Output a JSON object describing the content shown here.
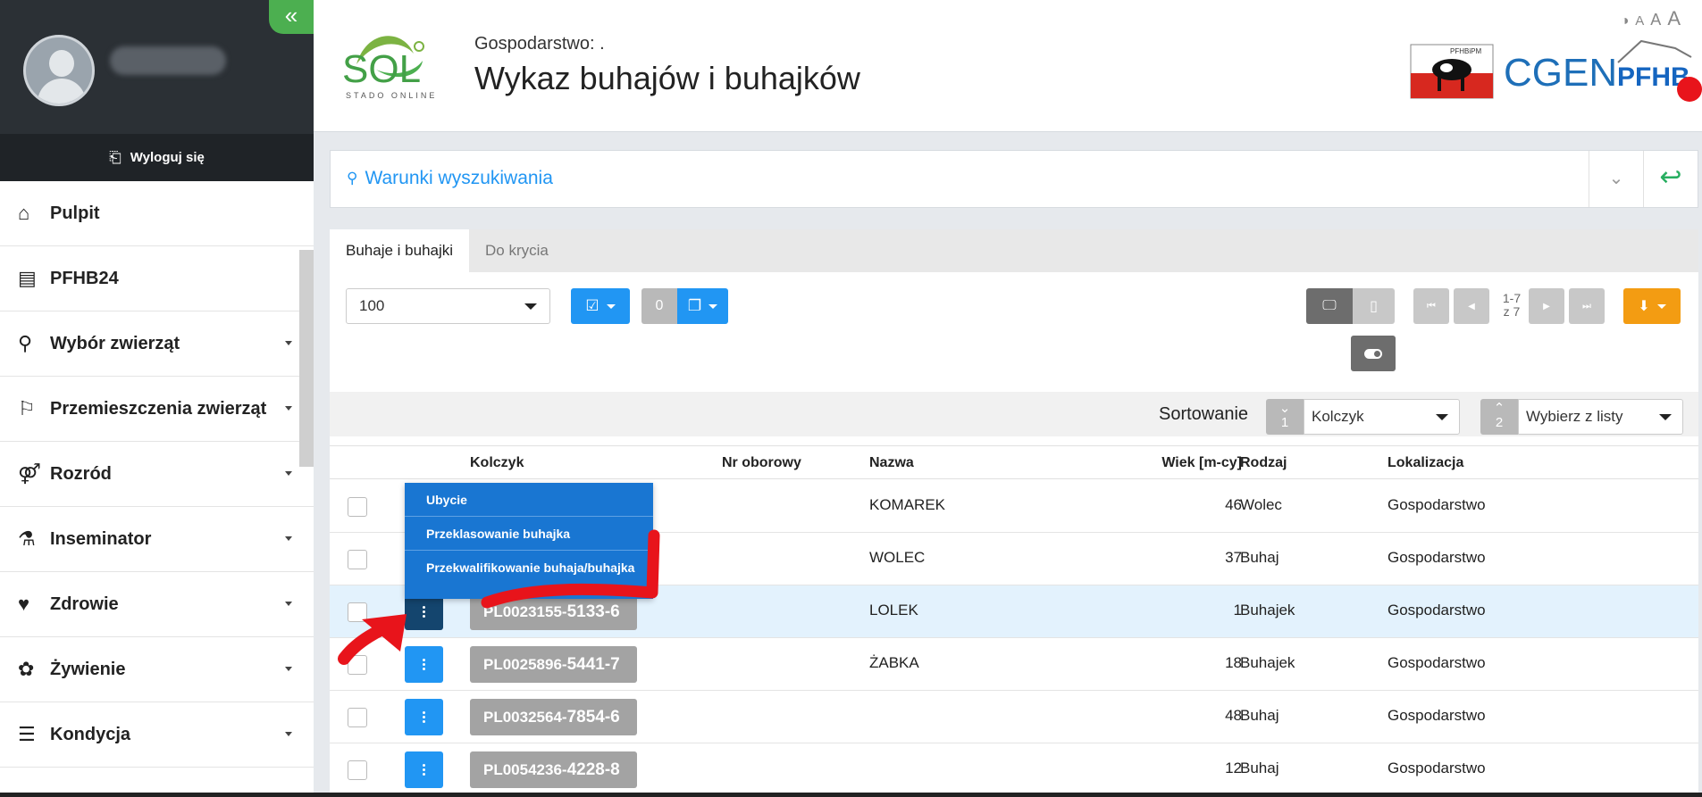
{
  "sidebar": {
    "collapse_icon": "«",
    "logout_label": "Wyloguj się",
    "items": [
      {
        "label": "Pulpit",
        "icon": "home-icon"
      },
      {
        "label": "PFHB24",
        "icon": "document-icon"
      },
      {
        "label": "Wybór zwierząt",
        "icon": "search-icon"
      },
      {
        "label": "Przemieszczenia zwierząt",
        "icon": "signpost-icon"
      },
      {
        "label": "Rozród",
        "icon": "gender-icon"
      },
      {
        "label": "Inseminator",
        "icon": "flask-icon"
      },
      {
        "label": "Zdrowie",
        "icon": "heartbeat-icon"
      },
      {
        "label": "Żywienie",
        "icon": "plant-icon"
      },
      {
        "label": "Kondycja",
        "icon": "bars-icon"
      }
    ]
  },
  "header": {
    "farm_label": "Gospodarstwo:",
    "farm_value": ".",
    "title": "Wykaz buhajów i buhajków",
    "logo_text": "SOL",
    "logo_sub": "STADO ONLINE",
    "a11y": {
      "contrast": "◑",
      "small": "A",
      "medium": "A",
      "large": "A"
    },
    "brand_logos": {
      "pfhbipm": "PFHBiPM",
      "cgen": "CGEN",
      "pfhb": "PFHB"
    }
  },
  "search": {
    "title": "Warunki wyszukiwania"
  },
  "tabs": [
    {
      "label": "Buhaje i buhajki",
      "active": true
    },
    {
      "label": "Do krycia",
      "active": false
    }
  ],
  "toolbar": {
    "page_size": "100",
    "selected_count": "0",
    "pagination_range": "1-7",
    "pagination_total": "z 7"
  },
  "sorting": {
    "label": "Sortowanie",
    "first": {
      "order": "1",
      "value": "Kolczyk"
    },
    "second": {
      "order": "2",
      "value": "Wybierz z listy"
    }
  },
  "table": {
    "columns": [
      "Kolczyk",
      "Nr oborowy",
      "Nazwa",
      "Wiek [m-cy]",
      "Rodzaj",
      "Lokalizacja"
    ],
    "rows": [
      {
        "tag_prefix": "",
        "tag_suffix": "",
        "nr": "",
        "name": "KOMAREK",
        "age": "46",
        "kind": "Wolec",
        "location": "Gospodarstwo"
      },
      {
        "tag_prefix": "",
        "tag_suffix": "",
        "nr": "",
        "name": "WOLEC",
        "age": "37",
        "kind": "Buhaj",
        "location": "Gospodarstwo"
      },
      {
        "tag_prefix": "PL0023155-",
        "tag_suffix": "5133-6",
        "nr": "",
        "name": "LOLEK",
        "age": "1",
        "kind": "Buhajek",
        "location": "Gospodarstwo"
      },
      {
        "tag_prefix": "PL0025896-",
        "tag_suffix": "5441-7",
        "nr": "",
        "name": "ŻABKA",
        "age": "18",
        "kind": "Buhajek",
        "location": "Gospodarstwo"
      },
      {
        "tag_prefix": "PL0032564-",
        "tag_suffix": "7854-6",
        "nr": "",
        "name": "",
        "age": "48",
        "kind": "Buhaj",
        "location": "Gospodarstwo"
      },
      {
        "tag_prefix": "PL0054236-",
        "tag_suffix": "4228-8",
        "nr": "",
        "name": "",
        "age": "12",
        "kind": "Buhaj",
        "location": "Gospodarstwo"
      }
    ]
  },
  "row_menu": {
    "items": [
      "Ubycie",
      "Przeklasowanie buhajka",
      "Przekwalifikowanie buhaja/buhajka"
    ]
  },
  "colors": {
    "accent": "#2196f3",
    "sidebar_dark": "#2b3035",
    "success": "#4caf50",
    "orange": "#f39c12",
    "annotation": "#e8141b"
  }
}
